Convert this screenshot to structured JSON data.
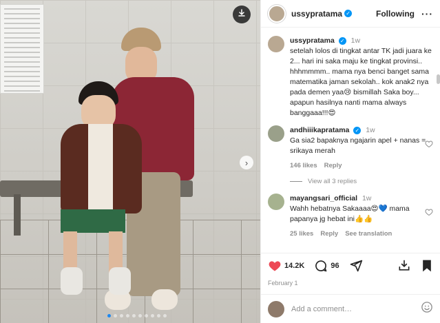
{
  "post": {
    "username": "ussypratama",
    "follow_label": "Following",
    "more_label": "···",
    "likes": "14.2K",
    "comments_count": "96",
    "date": "February 1",
    "colors": {
      "accent": "#0095f6",
      "like": "#ed4956",
      "dot_active": "#1e88f0"
    }
  },
  "caption": {
    "username": "ussypratama",
    "time": "1w",
    "text": "setelah lolos di tingkat antar TK jadi juara ke 2... hari ini saka maju ke tingkat provinsi.. hhhmmmm.. mama nya benci banget sama matematika jaman sekolah.. kok anak2 nya pada demen yaa😢 bismillah Saka boy... apapun hasilnya nanti mama always banggaaa!!!😍"
  },
  "comments": [
    {
      "username": "andhiiikapratama",
      "time": "1w",
      "text": "Ga sia2 bapaknya ngajarin apel + nanas = srikaya merah",
      "likes": "146 likes",
      "reply": "Reply",
      "view_replies": "View all 3 replies"
    },
    {
      "username": "mayangsari_official",
      "time": "1w",
      "text": "Wahh hebatnya Sakaaaa😍💙 mama papanya jg hebat ini👍👍",
      "likes": "25 likes",
      "reply": "Reply",
      "translation": "See translation"
    }
  ],
  "add_comment": {
    "placeholder": "Add a comment…"
  },
  "icons": [
    "download-icon",
    "next-arrow-icon",
    "verified-icon",
    "heart-icon",
    "comment-icon",
    "share-icon",
    "repost-icon",
    "bookmark-icon",
    "emoji-icon"
  ]
}
